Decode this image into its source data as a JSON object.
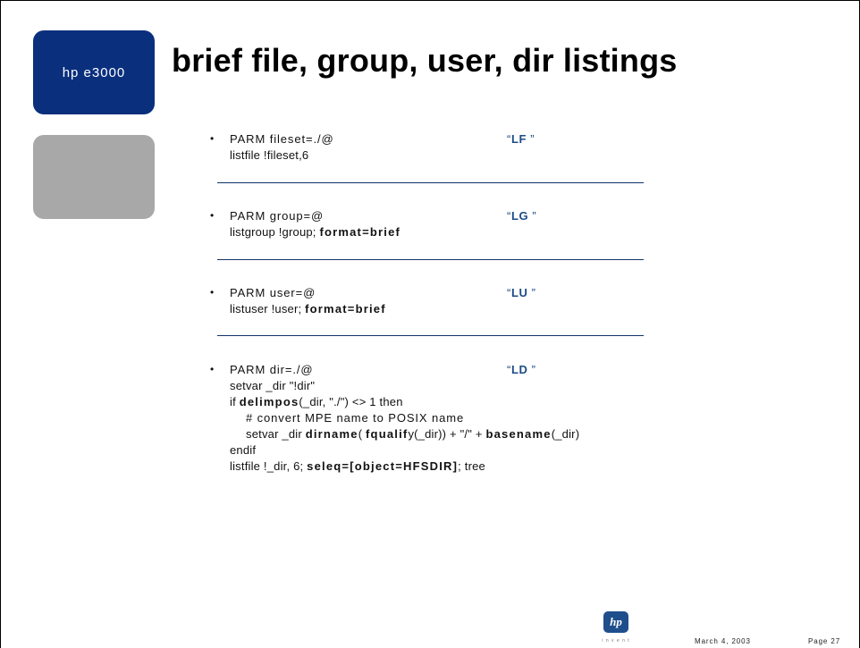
{
  "sidebar": {
    "brand": "hp e3000"
  },
  "title": "brief file, group, user, dir listings",
  "sections": {
    "lf": {
      "parm": "PARM fileset=./@",
      "cmd": "listfile !fileset,6",
      "label": "LF"
    },
    "lg": {
      "parm": "PARM group=@",
      "cmd_plain": "listgroup !group; ",
      "cmd_bold": "format=brief",
      "label": "LG"
    },
    "lu": {
      "parm": "PARM user=@",
      "cmd_plain": "listuser !user; ",
      "cmd_bold": "format=brief",
      "label": "LU"
    },
    "ld": {
      "parm": "PARM dir=./@",
      "label": "LD",
      "setvar1": "setvar _dir  \"!dir\"",
      "if_pre": "if ",
      "if_fn": "delimpos",
      "if_args": "(_dir, \"./\") <> 1 then",
      "comment": "# convert MPE name to POSIX name",
      "sv2_pre": "setvar _dir  ",
      "sv2_fn1": "dirname",
      "sv2_mid1": "( ",
      "sv2_fn2": "fqualif",
      "sv2_mid2": "y(_dir)) + \"/\" + ",
      "sv2_fn3": "basename",
      "sv2_end": "(_dir)",
      "endif": "endif",
      "lf_pre": "listfile !_dir, 6; ",
      "lf_bold": "seleq=[object=HFSDIR]",
      "lf_end": "; tree"
    }
  },
  "footer": {
    "logo_text": "hp",
    "logo_tag": "i n v e n t",
    "date": "March 4, 2003",
    "page": "Page 27"
  },
  "colors": {
    "brand_blue": "#0a2f7d",
    "label_blue": "#1c4c86",
    "rule": "#12336a",
    "grey_panel": "#a8a8a8"
  }
}
